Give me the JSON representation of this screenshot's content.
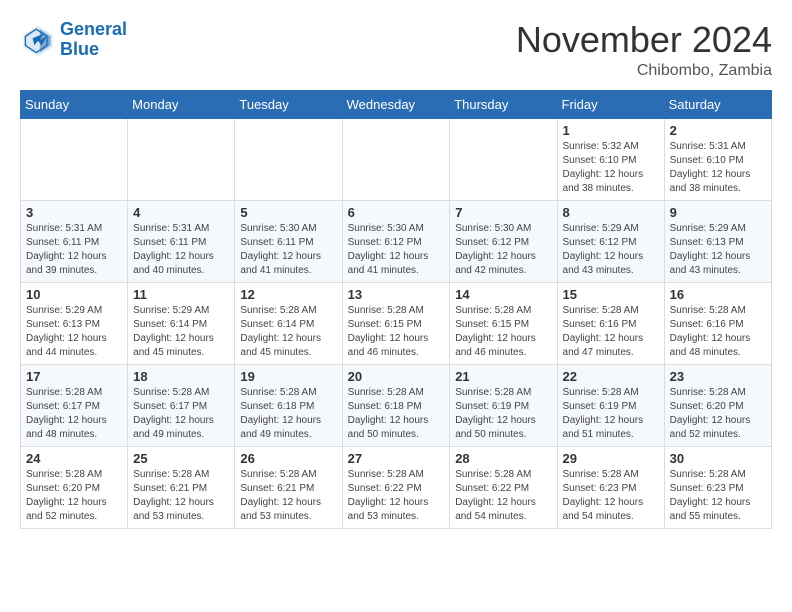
{
  "logo": {
    "line1": "General",
    "line2": "Blue"
  },
  "title": "November 2024",
  "subtitle": "Chibombo, Zambia",
  "weekdays": [
    "Sunday",
    "Monday",
    "Tuesday",
    "Wednesday",
    "Thursday",
    "Friday",
    "Saturday"
  ],
  "weeks": [
    [
      {
        "day": "",
        "detail": ""
      },
      {
        "day": "",
        "detail": ""
      },
      {
        "day": "",
        "detail": ""
      },
      {
        "day": "",
        "detail": ""
      },
      {
        "day": "",
        "detail": ""
      },
      {
        "day": "1",
        "detail": "Sunrise: 5:32 AM\nSunset: 6:10 PM\nDaylight: 12 hours\nand 38 minutes."
      },
      {
        "day": "2",
        "detail": "Sunrise: 5:31 AM\nSunset: 6:10 PM\nDaylight: 12 hours\nand 38 minutes."
      }
    ],
    [
      {
        "day": "3",
        "detail": "Sunrise: 5:31 AM\nSunset: 6:11 PM\nDaylight: 12 hours\nand 39 minutes."
      },
      {
        "day": "4",
        "detail": "Sunrise: 5:31 AM\nSunset: 6:11 PM\nDaylight: 12 hours\nand 40 minutes."
      },
      {
        "day": "5",
        "detail": "Sunrise: 5:30 AM\nSunset: 6:11 PM\nDaylight: 12 hours\nand 41 minutes."
      },
      {
        "day": "6",
        "detail": "Sunrise: 5:30 AM\nSunset: 6:12 PM\nDaylight: 12 hours\nand 41 minutes."
      },
      {
        "day": "7",
        "detail": "Sunrise: 5:30 AM\nSunset: 6:12 PM\nDaylight: 12 hours\nand 42 minutes."
      },
      {
        "day": "8",
        "detail": "Sunrise: 5:29 AM\nSunset: 6:12 PM\nDaylight: 12 hours\nand 43 minutes."
      },
      {
        "day": "9",
        "detail": "Sunrise: 5:29 AM\nSunset: 6:13 PM\nDaylight: 12 hours\nand 43 minutes."
      }
    ],
    [
      {
        "day": "10",
        "detail": "Sunrise: 5:29 AM\nSunset: 6:13 PM\nDaylight: 12 hours\nand 44 minutes."
      },
      {
        "day": "11",
        "detail": "Sunrise: 5:29 AM\nSunset: 6:14 PM\nDaylight: 12 hours\nand 45 minutes."
      },
      {
        "day": "12",
        "detail": "Sunrise: 5:28 AM\nSunset: 6:14 PM\nDaylight: 12 hours\nand 45 minutes."
      },
      {
        "day": "13",
        "detail": "Sunrise: 5:28 AM\nSunset: 6:15 PM\nDaylight: 12 hours\nand 46 minutes."
      },
      {
        "day": "14",
        "detail": "Sunrise: 5:28 AM\nSunset: 6:15 PM\nDaylight: 12 hours\nand 46 minutes."
      },
      {
        "day": "15",
        "detail": "Sunrise: 5:28 AM\nSunset: 6:16 PM\nDaylight: 12 hours\nand 47 minutes."
      },
      {
        "day": "16",
        "detail": "Sunrise: 5:28 AM\nSunset: 6:16 PM\nDaylight: 12 hours\nand 48 minutes."
      }
    ],
    [
      {
        "day": "17",
        "detail": "Sunrise: 5:28 AM\nSunset: 6:17 PM\nDaylight: 12 hours\nand 48 minutes."
      },
      {
        "day": "18",
        "detail": "Sunrise: 5:28 AM\nSunset: 6:17 PM\nDaylight: 12 hours\nand 49 minutes."
      },
      {
        "day": "19",
        "detail": "Sunrise: 5:28 AM\nSunset: 6:18 PM\nDaylight: 12 hours\nand 49 minutes."
      },
      {
        "day": "20",
        "detail": "Sunrise: 5:28 AM\nSunset: 6:18 PM\nDaylight: 12 hours\nand 50 minutes."
      },
      {
        "day": "21",
        "detail": "Sunrise: 5:28 AM\nSunset: 6:19 PM\nDaylight: 12 hours\nand 50 minutes."
      },
      {
        "day": "22",
        "detail": "Sunrise: 5:28 AM\nSunset: 6:19 PM\nDaylight: 12 hours\nand 51 minutes."
      },
      {
        "day": "23",
        "detail": "Sunrise: 5:28 AM\nSunset: 6:20 PM\nDaylight: 12 hours\nand 52 minutes."
      }
    ],
    [
      {
        "day": "24",
        "detail": "Sunrise: 5:28 AM\nSunset: 6:20 PM\nDaylight: 12 hours\nand 52 minutes."
      },
      {
        "day": "25",
        "detail": "Sunrise: 5:28 AM\nSunset: 6:21 PM\nDaylight: 12 hours\nand 53 minutes."
      },
      {
        "day": "26",
        "detail": "Sunrise: 5:28 AM\nSunset: 6:21 PM\nDaylight: 12 hours\nand 53 minutes."
      },
      {
        "day": "27",
        "detail": "Sunrise: 5:28 AM\nSunset: 6:22 PM\nDaylight: 12 hours\nand 53 minutes."
      },
      {
        "day": "28",
        "detail": "Sunrise: 5:28 AM\nSunset: 6:22 PM\nDaylight: 12 hours\nand 54 minutes."
      },
      {
        "day": "29",
        "detail": "Sunrise: 5:28 AM\nSunset: 6:23 PM\nDaylight: 12 hours\nand 54 minutes."
      },
      {
        "day": "30",
        "detail": "Sunrise: 5:28 AM\nSunset: 6:23 PM\nDaylight: 12 hours\nand 55 minutes."
      }
    ]
  ]
}
